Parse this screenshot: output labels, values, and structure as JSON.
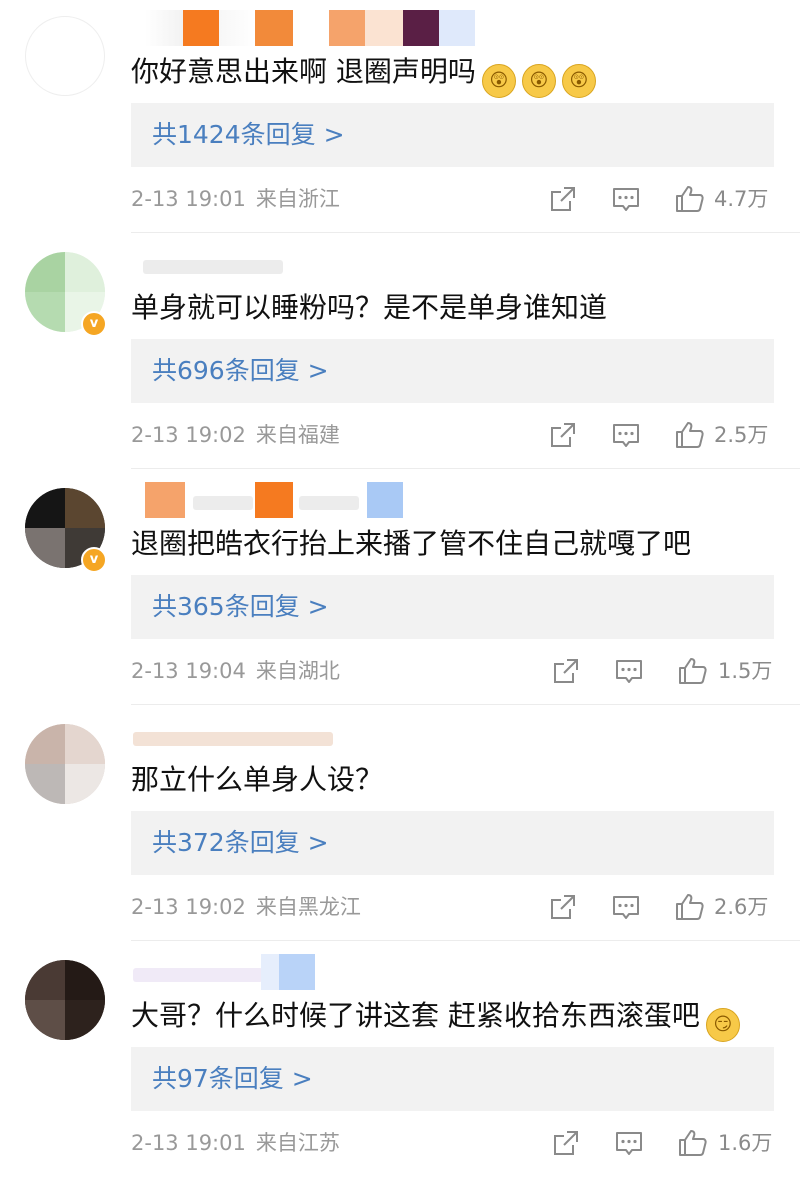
{
  "comments": [
    {
      "text": "你好意思出来啊 退圈声明吗",
      "emojis": [
        "😲",
        "😲",
        "😲"
      ],
      "replies_label": "共1424条回复 >",
      "date": "2-13 19:01",
      "location": "来自浙江",
      "likes": "4.7万"
    },
    {
      "text": "单身就可以睡粉吗？是不是单身谁知道",
      "emojis": [],
      "replies_label": "共696条回复 >",
      "date": "2-13 19:02",
      "location": "来自福建",
      "likes": "2.5万"
    },
    {
      "text": "退圈把皓衣行抬上来播了管不住自己就嘎了吧",
      "emojis": [],
      "replies_label": "共365条回复 >",
      "date": "2-13 19:04",
      "location": "来自湖北",
      "likes": "1.5万"
    },
    {
      "text": "那立什么单身人设？",
      "emojis": [],
      "replies_label": "共372条回复 >",
      "date": "2-13 19:02",
      "location": "来自黑龙江",
      "likes": "2.6万"
    },
    {
      "text": "大哥？什么时候了讲这套 赶紧收拾东西滚蛋吧",
      "emojis": [
        "😏"
      ],
      "replies_label": "共97条回复 >",
      "date": "2-13 19:01",
      "location": "来自江苏",
      "likes": "1.6万"
    }
  ],
  "icons": {
    "share": "share-icon",
    "comment": "comment-icon",
    "like": "thumbs-up-icon",
    "verified": "verified-badge-icon"
  },
  "colors": {
    "reply_link": "#4a7fbf",
    "meta_text": "#999999",
    "reply_box_bg": "#f2f2f2",
    "verified_badge": "#f5a623"
  }
}
